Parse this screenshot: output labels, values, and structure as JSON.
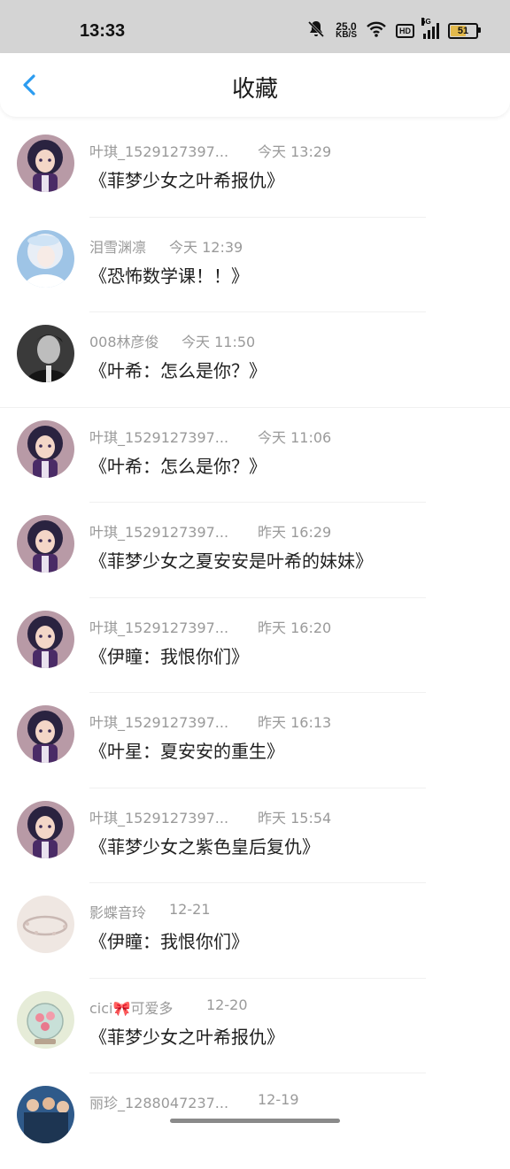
{
  "status_bar": {
    "time": "13:33",
    "net_speed_value": "25.0",
    "net_speed_unit": "KB/S",
    "hd_label": "HD",
    "signal_label": "5G",
    "battery": "51"
  },
  "header": {
    "title": "收藏"
  },
  "items": [
    {
      "name": "叶琪_1529127397...",
      "time": "今天 13:29",
      "title": "《菲梦少女之叶希报仇》",
      "avatar": "purple-girl"
    },
    {
      "name": "泪雪渊凛",
      "time": "今天 12:39",
      "title": "《恐怖数学课！！》",
      "avatar": "white-princess"
    },
    {
      "name": "008林彦俊",
      "time": "今天 11:50",
      "title": "《叶希：怎么是你？》",
      "avatar": "dark-portrait"
    },
    {
      "name": "叶琪_1529127397...",
      "time": "今天 11:06",
      "title": "《叶希：怎么是你？》",
      "avatar": "purple-girl"
    },
    {
      "name": "叶琪_1529127397...",
      "time": "昨天 16:29",
      "title": "《菲梦少女之夏安安是叶希的妹妹》",
      "avatar": "purple-girl"
    },
    {
      "name": "叶琪_1529127397...",
      "time": "昨天 16:20",
      "title": "《伊瞳：我恨你们》",
      "avatar": "purple-girl"
    },
    {
      "name": "叶琪_1529127397...",
      "time": "昨天 16:13",
      "title": "《叶星：夏安安的重生》",
      "avatar": "purple-girl"
    },
    {
      "name": "叶琪_1529127397...",
      "time": "昨天 15:54",
      "title": "《菲梦少女之紫色皇后复仇》",
      "avatar": "purple-girl"
    },
    {
      "name": "影蝶音玲",
      "time": "12-21",
      "title": "《伊瞳：我恨你们》",
      "avatar": "bracelet"
    },
    {
      "name": "cici🎀可爱多",
      "time": "12-20",
      "title": "《菲梦少女之叶希报仇》",
      "avatar": "flower-globe"
    },
    {
      "name": "丽珍_1288047237...",
      "time": "12-19",
      "title": "",
      "avatar": "group-photo"
    }
  ]
}
